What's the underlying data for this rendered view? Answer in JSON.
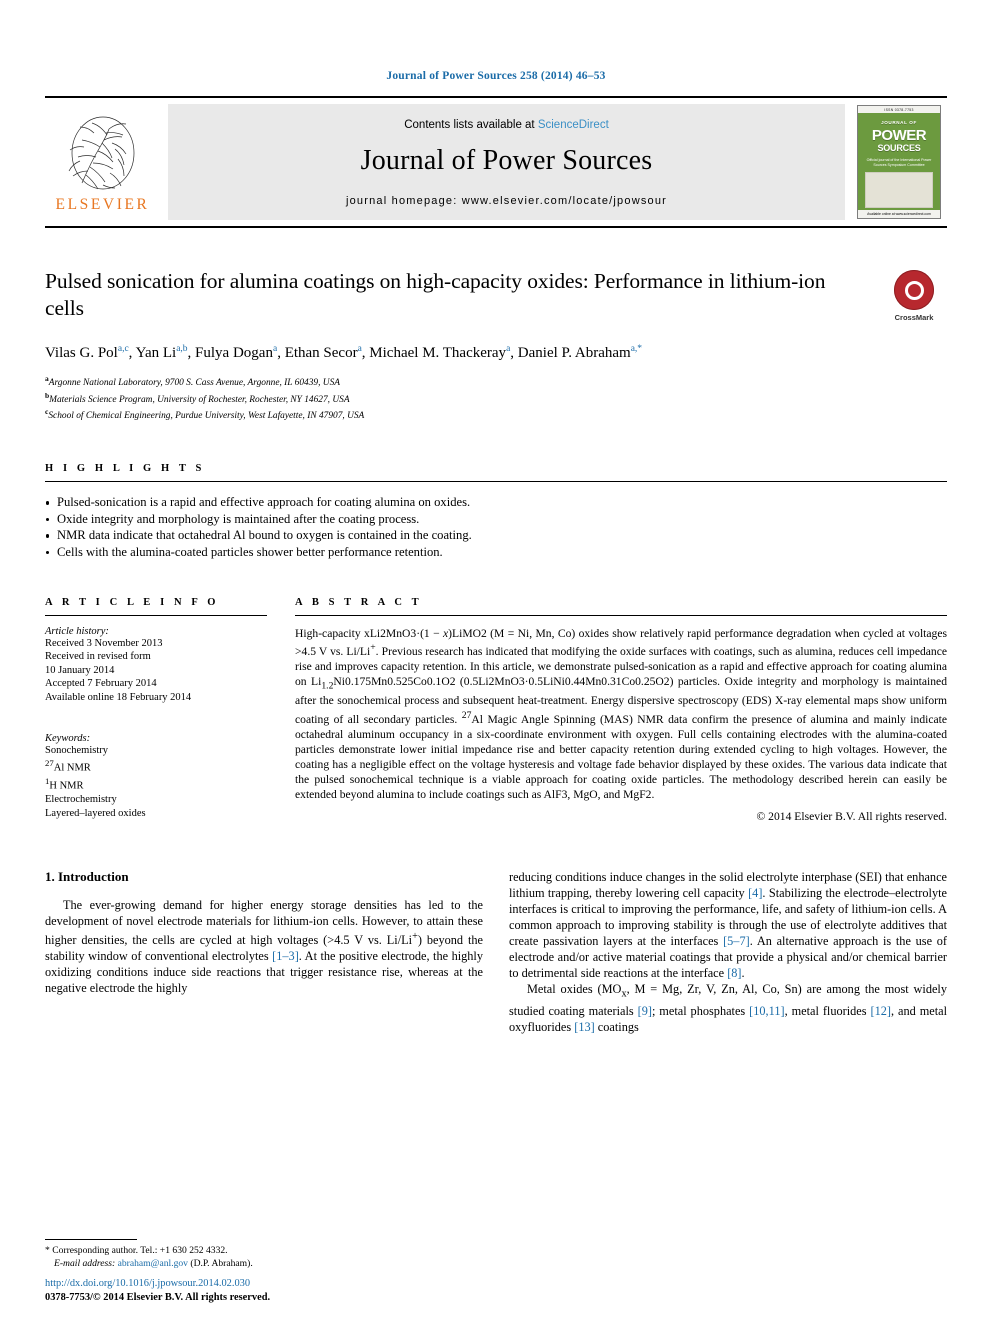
{
  "running_head": "Journal of Power Sources 258 (2014) 46–53",
  "masthead": {
    "publisher": "ELSEVIER",
    "contents_prefix": "Contents lists available at ",
    "sciencedirect": "ScienceDirect",
    "journal_name": "Journal of Power Sources",
    "homepage": "journal homepage: www.elsevier.com/locate/jpowsour",
    "cover": {
      "top_label": "ISSN 0378-7753",
      "title_line1": "JOURNAL OF",
      "title_line2": "POWER",
      "title_line3": "SOURCES",
      "subtitle": "Official journal of the International Power Sources Symposium Committee",
      "bottom_label": "Available online at www.sciencedirect.com"
    }
  },
  "article": {
    "title": "Pulsed sonication for alumina coatings on high-capacity oxides: Performance in lithium-ion cells",
    "crossmark_label": "CrossMark",
    "authors": [
      {
        "name": "Vilas G. Pol",
        "marks": "a,c",
        "sep": ", "
      },
      {
        "name": "Yan Li",
        "marks": "a,b",
        "sep": ", "
      },
      {
        "name": "Fulya Dogan",
        "marks": "a",
        "sep": ", "
      },
      {
        "name": "Ethan Secor",
        "marks": "a",
        "sep": ", "
      },
      {
        "name": "Michael M. Thackeray",
        "marks": "a",
        "sep": ", "
      },
      {
        "name": "Daniel P. Abraham",
        "marks": "a,*",
        "sep": ""
      }
    ],
    "affiliations": [
      {
        "mark": "a",
        "text": "Argonne National Laboratory, 9700 S. Cass Avenue, Argonne, IL 60439, USA"
      },
      {
        "mark": "b",
        "text": "Materials Science Program, University of Rochester, Rochester, NY 14627, USA"
      },
      {
        "mark": "c",
        "text": "School of Chemical Engineering, Purdue University, West Lafayette, IN 47907, USA"
      }
    ]
  },
  "highlights": {
    "heading": "H I G H L I G H T S",
    "items": [
      "Pulsed-sonication is a rapid and effective approach for coating alumina on oxides.",
      "Oxide integrity and morphology is maintained after the coating process.",
      "NMR data indicate that octahedral Al bound to oxygen is contained in the coating.",
      "Cells with the alumina-coated particles shower better performance retention."
    ]
  },
  "article_info": {
    "heading": "A R T I C L E   I N F O",
    "history_title": "Article history:",
    "history": [
      "Received 3 November 2013",
      "Received in revised form",
      "10 January 2014",
      "Accepted 7 February 2014",
      "Available online 18 February 2014"
    ],
    "keywords_title": "Keywords:",
    "keywords": [
      "Sonochemistry",
      "27Al NMR",
      "1H NMR",
      "Electrochemistry",
      "Layered–layered oxides"
    ]
  },
  "abstract": {
    "heading": "A B S T R A C T",
    "text": "High-capacity xLi2MnO3·(1 − x)LiMO2 (M = Ni, Mn, Co) oxides show relatively rapid performance degradation when cycled at voltages >4.5 V vs. Li/Li+. Previous research has indicated that modifying the oxide surfaces with coatings, such as alumina, reduces cell impedance rise and improves capacity retention. In this article, we demonstrate pulsed-sonication as a rapid and effective approach for coating alumina on Li1.2Ni0.175Mn0.525Co0.1O2 (0.5Li2MnO3·0.5LiNi0.44Mn0.31Co0.25O2) particles. Oxide integrity and morphology is maintained after the sonochemical process and subsequent heat-treatment. Energy dispersive spectroscopy (EDS) X-ray elemental maps show uniform coating of all secondary particles. 27Al Magic Angle Spinning (MAS) NMR data confirm the presence of alumina and mainly indicate octahedral aluminum occupancy in a six-coordinate environment with oxygen. Full cells containing electrodes with the alumina-coated particles demonstrate lower initial impedance rise and better capacity retention during extended cycling to high voltages. However, the coating has a negligible effect on the voltage hysteresis and voltage fade behavior displayed by these oxides. The various data indicate that the pulsed sonochemical technique is a viable approach for coating oxide particles. The methodology described herein can easily be extended beyond alumina to include coatings such as AlF3, MgO, and MgF2.",
    "copyright": "© 2014 Elsevier B.V. All rights reserved."
  },
  "body": {
    "section_number_title": "1.  Introduction",
    "left_paragraph": "The ever-growing demand for higher energy storage densities has led to the development of novel electrode materials for lithium-ion cells. However, to attain these higher densities, the cells are cycled at high voltages (>4.5 V vs. Li/Li+) beyond the stability window of conventional electrolytes [1–3]. At the positive electrode, the highly oxidizing conditions induce side reactions that trigger resistance rise, whereas at the negative electrode the highly",
    "right_paragraph_1": "reducing conditions induce changes in the solid electrolyte interphase (SEI) that enhance lithium trapping, thereby lowering cell capacity [4]. Stabilizing the electrode–electrolyte interfaces is critical to improving the performance, life, and safety of lithium-ion cells. A common approach to improving stability is through the use of electrolyte additives that create passivation layers at the interfaces [5–7]. An alternative approach is the use of electrode and/or active material coatings that provide a physical and/or chemical barrier to detrimental side reactions at the interface [8].",
    "right_paragraph_2": "Metal oxides (MOx, M = Mg, Zr, V, Zn, Al, Co, Sn) are among the most widely studied coating materials [9]; metal phosphates [10,11], metal fluorides [12], and metal oxyfluorides [13] coatings"
  },
  "footer": {
    "corresponding": "* Corresponding author. Tel.: +1 630 252 4332.",
    "email_label": "E-mail address:",
    "email": "abraham@anl.gov",
    "email_suffix": "(D.P. Abraham).",
    "doi": "http://dx.doi.org/10.1016/j.jpowsour.2014.02.030",
    "issn": "0378-7753/© 2014 Elsevier B.V. All rights reserved."
  },
  "colors": {
    "link": "#1b6ca8",
    "elsevier_orange": "#e87722",
    "cover_green": "#6c9a3f",
    "crossmark_red": "#b7282e"
  }
}
